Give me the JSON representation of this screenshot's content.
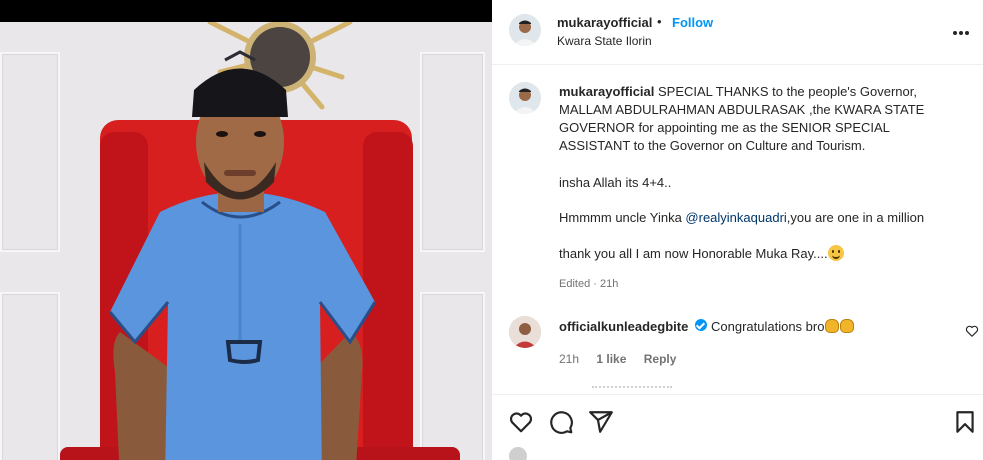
{
  "post": {
    "username": "mukarayofficial",
    "separator": "•",
    "follow_label": "Follow",
    "location": "Kwara State Ilorin"
  },
  "caption": {
    "username": "mukarayofficial",
    "line1": " SPECIAL THANKS to the people's Governor,",
    "line2": "MALLAM ABDULRAHMAN ABDULRASAK ,the KWARA STATE",
    "line3": "GOVERNOR for appointing me as the SENIOR SPECIAL",
    "line4": "ASSISTANT to the Governor on Culture and Tourism.",
    "para2": "insha Allah its 4+4..",
    "para3_pre": "Hmmmm uncle Yinka ",
    "para3_mention": "@realyinkaquadri",
    "para3_post": ",you are one in a million",
    "para4": "thank you all I am now Honorable Muka Ray....",
    "edited": "Edited",
    "edited_sep": " · ",
    "time": "21h"
  },
  "comment": {
    "username": "officialkunleadegbite",
    "text": "Congratulations bro",
    "time": "21h",
    "likes": "1 like",
    "reply": "Reply"
  },
  "actions": {
    "like_icon": "heart-icon",
    "comment_icon": "comment-icon",
    "share_icon": "share-icon",
    "save_icon": "bookmark-icon"
  },
  "colors": {
    "accent": "#0095f6",
    "mention": "#00376b",
    "muted": "#737373"
  }
}
